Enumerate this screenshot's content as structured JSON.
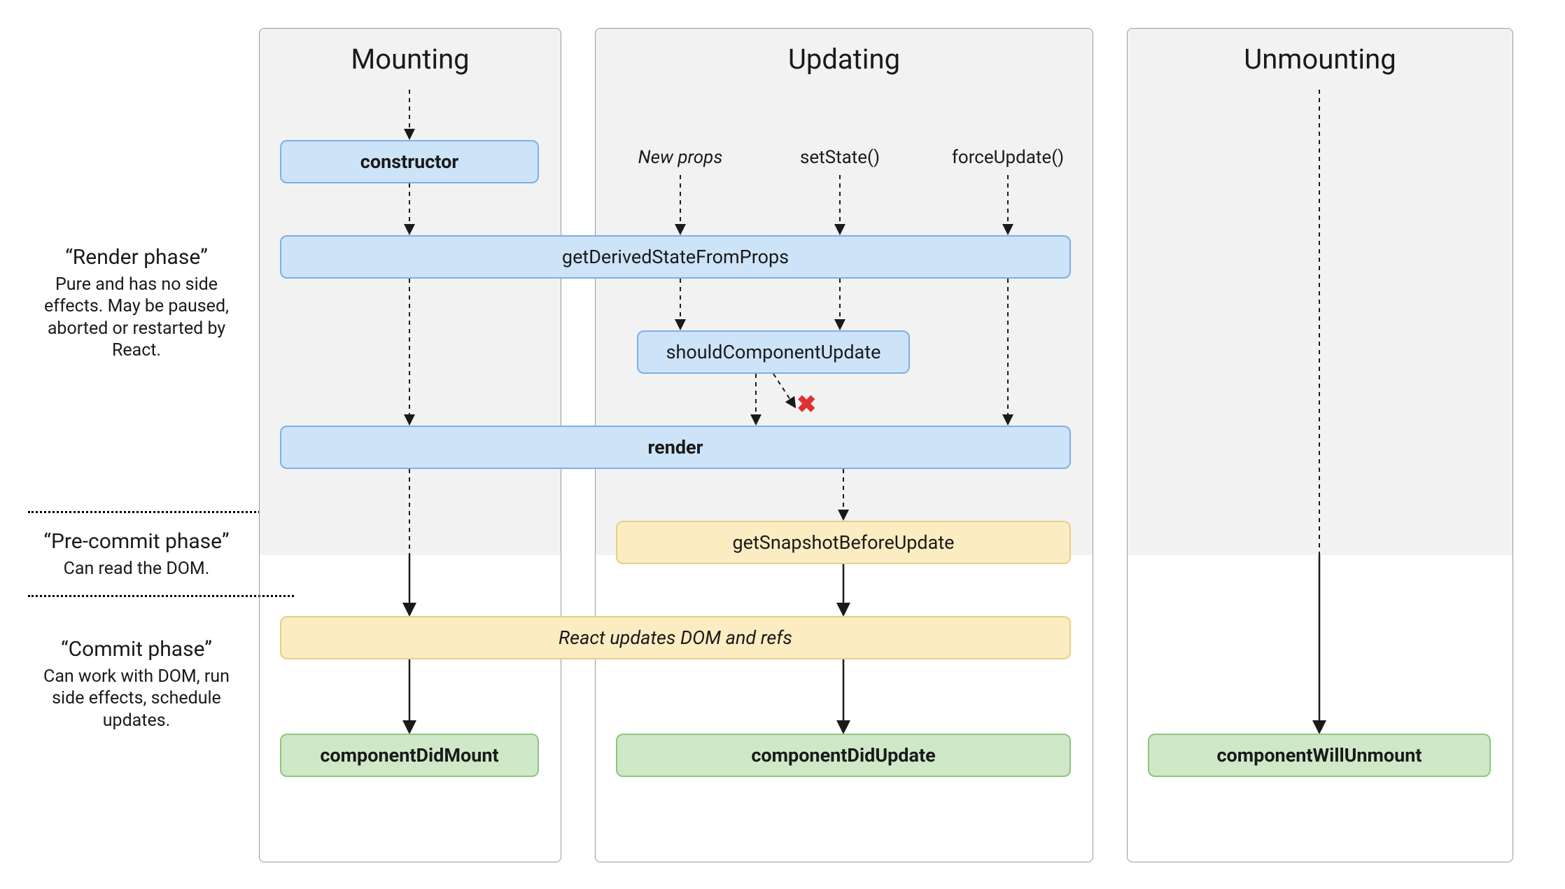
{
  "phases": {
    "render": {
      "title": "“Render phase”",
      "desc": "Pure and has no side effects. May be paused, aborted or restarted by React."
    },
    "precommit": {
      "title": "“Pre-commit phase”",
      "desc": "Can read the DOM."
    },
    "commit": {
      "title": "“Commit phase”",
      "desc": "Can work with DOM, run side effects, schedule updates."
    }
  },
  "columns": {
    "mounting": {
      "title": "Mounting"
    },
    "updating": {
      "title": "Updating"
    },
    "unmounting": {
      "title": "Unmounting"
    }
  },
  "triggers": {
    "newProps": "New props",
    "setState": "setState()",
    "forceUpdate": "forceUpdate()"
  },
  "boxes": {
    "constructor": "constructor",
    "getDerivedState": "getDerivedStateFromProps",
    "shouldComponentUpdate": "shouldComponentUpdate",
    "render": "render",
    "getSnapshotBeforeUpdate": "getSnapshotBeforeUpdate",
    "reactUpdatesDom": "React updates DOM and refs",
    "componentDidMount": "componentDidMount",
    "componentDidUpdate": "componentDidUpdate",
    "componentWillUnmount": "componentWillUnmount"
  },
  "symbols": {
    "x": "✖"
  }
}
